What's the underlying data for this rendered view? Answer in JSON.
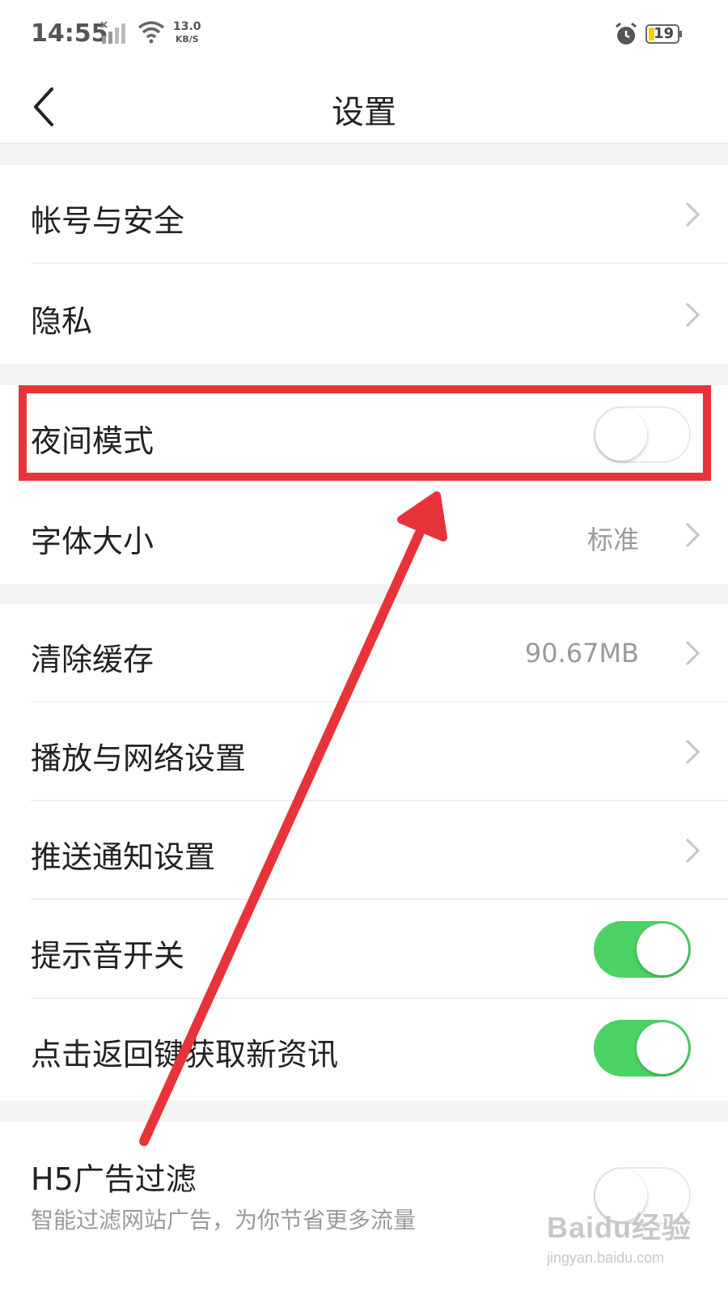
{
  "status_bar": {
    "time": "14:55",
    "net_speed_value": "13.0",
    "net_speed_unit": "KB/S",
    "battery_level": "19",
    "icons": [
      "signal-icon",
      "wifi-icon",
      "alarm-icon",
      "battery-icon"
    ]
  },
  "nav": {
    "title": "设置",
    "back_icon": "chevron-left-icon"
  },
  "settings": {
    "account_security": {
      "label": "帐号与安全"
    },
    "privacy": {
      "label": "隐私"
    },
    "night_mode": {
      "label": "夜间模式",
      "enabled": false
    },
    "font_size": {
      "label": "字体大小",
      "value": "标准"
    },
    "clear_cache": {
      "label": "清除缓存",
      "value": "90.67MB"
    },
    "playback_network": {
      "label": "播放与网络设置"
    },
    "push_notifications": {
      "label": "推送通知设置"
    },
    "sound_toggle": {
      "label": "提示音开关",
      "enabled": true
    },
    "back_refresh": {
      "label": "点击返回键获取新资讯",
      "enabled": true
    },
    "h5_ad_filter": {
      "label": "H5广告过滤",
      "description": "智能过滤网站广告，为你节省更多流量",
      "enabled": false
    }
  },
  "colors": {
    "toggle_on": "#4cd264",
    "highlight": "#e8333a",
    "background": "#f4f4f4"
  },
  "watermark": {
    "main": "Baidu经验",
    "sub": "jingyan.baidu.com"
  }
}
